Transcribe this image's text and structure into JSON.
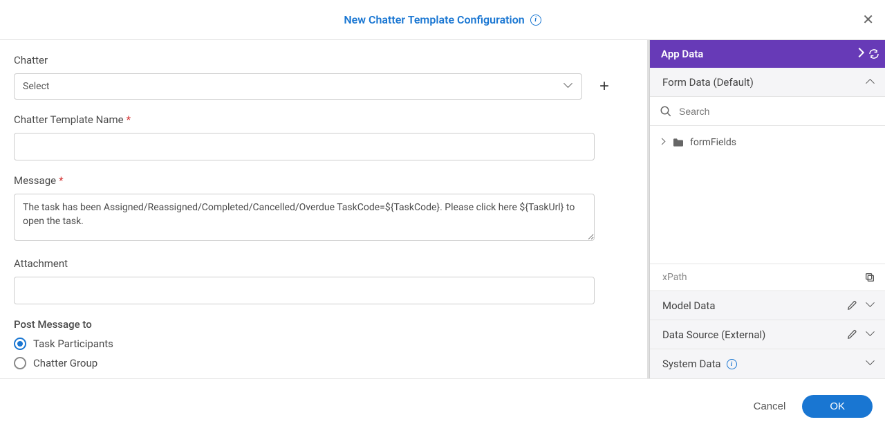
{
  "header": {
    "title": "New Chatter Template Configuration"
  },
  "form": {
    "chatter": {
      "label": "Chatter",
      "select_placeholder": "Select"
    },
    "template_name": {
      "label": "Chatter Template Name",
      "value": ""
    },
    "message": {
      "label": "Message",
      "value": "The task has been Assigned/Reassigned/Completed/Cancelled/Overdue TaskCode=${TaskCode}. Please click here ${TaskUrl} to open the task."
    },
    "attachment": {
      "label": "Attachment",
      "value": ""
    },
    "post_to": {
      "label": "Post Message to",
      "options": [
        {
          "label": "Task Participants",
          "checked": true
        },
        {
          "label": "Chatter Group",
          "checked": false
        }
      ]
    }
  },
  "sidebar": {
    "title": "App Data",
    "sections": {
      "form_data": {
        "label": "Form Data (Default)",
        "search_placeholder": "Search",
        "tree": [
          {
            "label": "formFields"
          }
        ]
      },
      "xpath_label": "xPath",
      "model_data": {
        "label": "Model Data"
      },
      "data_source": {
        "label": "Data Source (External)"
      },
      "system_data": {
        "label": "System Data"
      }
    }
  },
  "footer": {
    "cancel": "Cancel",
    "ok": "OK"
  }
}
